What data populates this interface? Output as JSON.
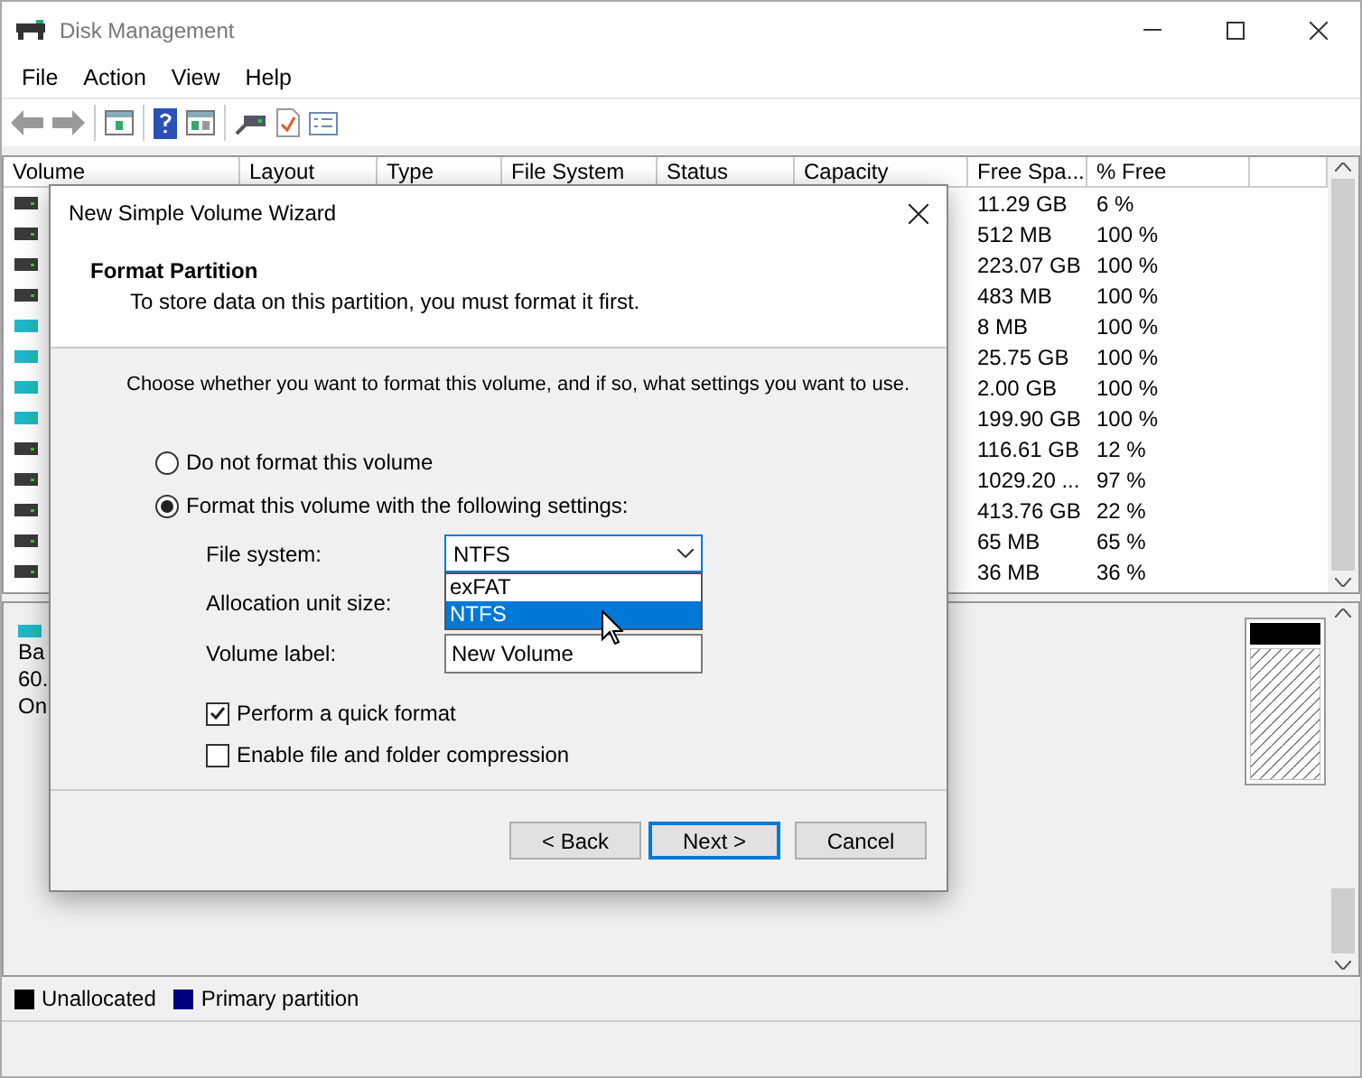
{
  "window": {
    "title": "Disk Management"
  },
  "menu": [
    "File",
    "Action",
    "View",
    "Help"
  ],
  "table": {
    "columns": [
      "Volume",
      "Layout",
      "Type",
      "File System",
      "Status",
      "Capacity",
      "Free Spa...",
      "% Free"
    ],
    "rows": [
      {
        "free": "11.29 GB",
        "pct": "6 %",
        "color": "#3a3a3a"
      },
      {
        "free": "512 MB",
        "pct": "100 %",
        "color": "#3a3a3a"
      },
      {
        "free": "223.07 GB",
        "pct": "100 %",
        "color": "#3a3a3a"
      },
      {
        "free": "483 MB",
        "pct": "100 %",
        "color": "#3a3a3a"
      },
      {
        "free": "8 MB",
        "pct": "100 %",
        "color": "#1cb8c8"
      },
      {
        "free": "25.75 GB",
        "pct": "100 %",
        "color": "#1cb8c8"
      },
      {
        "free": "2.00 GB",
        "pct": "100 %",
        "color": "#1cb8c8"
      },
      {
        "free": "199.90 GB",
        "pct": "100 %",
        "color": "#1cb8c8"
      },
      {
        "free": "116.61 GB",
        "pct": "12 %",
        "color": "#3a3a3a"
      },
      {
        "free": "1029.20 ...",
        "pct": "97 %",
        "color": "#3a3a3a"
      },
      {
        "free": "413.76 GB",
        "pct": "22 %",
        "color": "#3a3a3a"
      },
      {
        "free": "65 MB",
        "pct": "65 %",
        "color": "#3a3a3a"
      },
      {
        "free": "36 MB",
        "pct": "36 %",
        "color": "#3a3a3a"
      }
    ]
  },
  "disk": {
    "lines": [
      "Ba",
      "60.",
      "On"
    ],
    "partitions": [
      {
        "kind": "unallocated"
      }
    ]
  },
  "legend": [
    {
      "label": "Unallocated",
      "color": "#000000"
    },
    {
      "label": "Primary partition",
      "color": "#000080"
    }
  ],
  "dialog": {
    "title": "New Simple Volume Wizard",
    "heading": "Format Partition",
    "subtitle": "To store data on this partition, you must format it first.",
    "intro": "Choose whether you want to format this volume, and if so, what settings you want to use.",
    "options": [
      {
        "label": "Do not format this volume",
        "selected": false
      },
      {
        "label": "Format this volume with the following settings:",
        "selected": true
      }
    ],
    "file_system": {
      "label": "File system:",
      "value": "NTFS",
      "expanded": true,
      "choices": [
        {
          "label": "exFAT",
          "selected": false
        },
        {
          "label": "NTFS",
          "selected": true
        }
      ]
    },
    "allocation": {
      "label": "Allocation unit size:"
    },
    "volume_label": {
      "label": "Volume label:",
      "value": "New Volume"
    },
    "checks": [
      {
        "label": "Perform a quick format",
        "checked": true
      },
      {
        "label": "Enable file and folder compression",
        "checked": false
      }
    ],
    "buttons": [
      {
        "label": "< Back",
        "default": false
      },
      {
        "label": "Next >",
        "default": true
      },
      {
        "label": "Cancel",
        "default": false
      }
    ]
  }
}
